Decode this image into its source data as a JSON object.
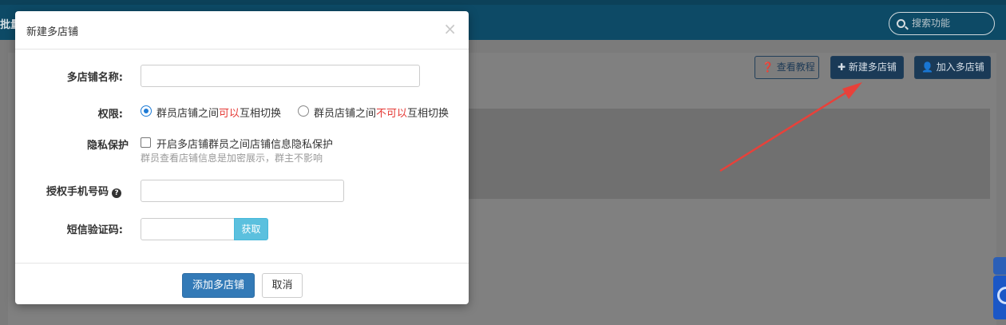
{
  "background": {
    "nav_left_text": "批量",
    "search_placeholder": "搜索功能",
    "buttons": {
      "tutorial": "查看教程",
      "new_shop": "新建多店铺",
      "join_shop": "加入多店铺"
    }
  },
  "modal": {
    "title": "新建多店铺",
    "close": "×",
    "fields": {
      "shop_name_label": "多店铺名称:",
      "permission_label": "权限:",
      "permission_options": [
        {
          "prefix": "群员店铺之间",
          "highlight": "可以",
          "suffix": "互相切换",
          "selected": true
        },
        {
          "prefix": "群员店铺之间",
          "highlight": "不可以",
          "suffix": "互相切换",
          "selected": false
        }
      ],
      "privacy_label": "隐私保护",
      "privacy_checkbox_text": "开启多店铺群员之间店铺信息隐私保护",
      "privacy_hint": "群员查看店铺信息是加密展示，群主不影响",
      "phone_label": "授权手机号码",
      "sms_label": "短信验证码:",
      "sms_get_button": "获取"
    },
    "footer": {
      "submit": "添加多店铺",
      "cancel": "取消"
    }
  },
  "colors": {
    "primary": "#337ab7",
    "info": "#5bc0de",
    "highlight_red": "#e53935",
    "annotation_arrow": "#e8413a"
  }
}
